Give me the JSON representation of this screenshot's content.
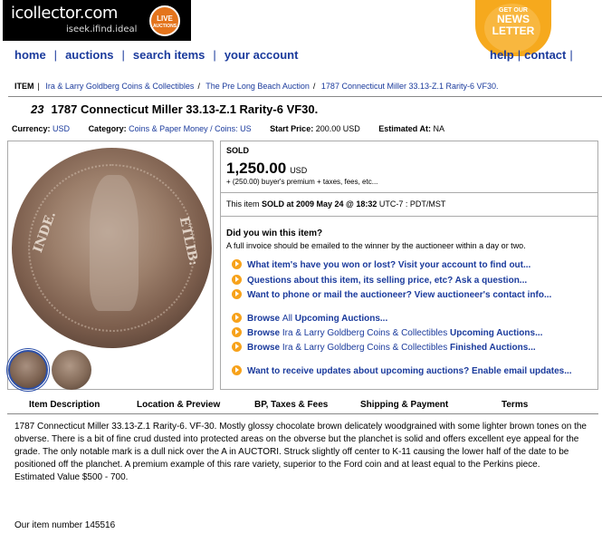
{
  "header": {
    "logo_text": "icollector.com",
    "logo_tagline": "iseek.ifind.ideal",
    "live_badge": {
      "main": "LIVE",
      "sub": "AUCTIONS"
    },
    "newsletter_badge": {
      "line1": "GET OUR",
      "line2": "NEWS",
      "line3": "LETTER"
    }
  },
  "nav": {
    "items": [
      "home",
      "auctions",
      "search items",
      "your account"
    ],
    "help": "help",
    "contact": "contact"
  },
  "breadcrumb": {
    "label": "ITEM",
    "items": [
      "Ira & Larry Goldberg Coins & Collectibles",
      "The Pre Long Beach Auction",
      "1787 Connecticut Miller 33.13-Z.1 Rarity-6 VF30."
    ]
  },
  "item": {
    "number": "23",
    "title": "1787 Connecticut Miller 33.13-Z.1 Rarity-6 VF30.",
    "currency_label": "Currency:",
    "currency": "USD",
    "category_label": "Category:",
    "category": "Coins & Paper Money / Coins: US",
    "start_price_label": "Start Price:",
    "start_price": "200.00 USD",
    "estimated_label": "Estimated At:",
    "estimated": "NA"
  },
  "image": {
    "legend_left": "INDE.",
    "legend_right": "ETLIB:"
  },
  "sale": {
    "status": "SOLD",
    "price": "1,250.00",
    "price_currency": "USD",
    "premium": "+ (250.00) buyer's premium + taxes, fees, etc...",
    "sold_prefix": "This item ",
    "sold_bold": "SOLD at 2009 May 24 @ 18:32",
    "sold_suffix": " UTC-7 : PDT/MST",
    "did_you_win": "Did you win this item?",
    "invoice_note": "A full invoice should be emailed to the winner by the auctioneer within a day or two."
  },
  "action_links": [
    {
      "label": "What item's have you won or lost? Visit your account to find out..."
    },
    {
      "label": "Questions about this item, its selling price, etc? Ask a question..."
    },
    {
      "label": "Want to phone or mail the auctioneer? View auctioneer's contact info..."
    },
    {
      "pre": "Browse ",
      "plain": "All",
      "post": " Upcoming Auctions..."
    },
    {
      "pre": "Browse ",
      "plain": "Ira & Larry Goldberg Coins & Collectibles",
      "post": " Upcoming Auctions..."
    },
    {
      "pre": "Browse ",
      "plain": "Ira & Larry Goldberg Coins & Collectibles",
      "post": " Finished Auctions..."
    },
    {
      "label": "Want to receive updates about upcoming auctions? Enable email updates..."
    }
  ],
  "tabs": [
    "Item Description",
    "Location & Preview",
    "BP, Taxes & Fees",
    "Shipping & Payment",
    "Terms"
  ],
  "description": {
    "text": "1787 Connecticut Miller 33.13-Z.1 Rarity-6. VF-30. Mostly glossy chocolate brown delicately woodgrained with some lighter brown tones on the obverse. There is a bit of fine crud dusted into protected areas on the obverse but the planchet is solid and offers excellent eye appeal for the grade. The only notable mark is a dull nick over the A in AUCTORI. Struck slightly off center to K-11 causing the lower half of the date to be positioned off the planchet. A premium example of this rare variety, superior to the Ford coin and at least equal to the Perkins piece.",
    "estimate": "Estimated Value $500 - 700.",
    "item_number": "Our item number 145516"
  }
}
